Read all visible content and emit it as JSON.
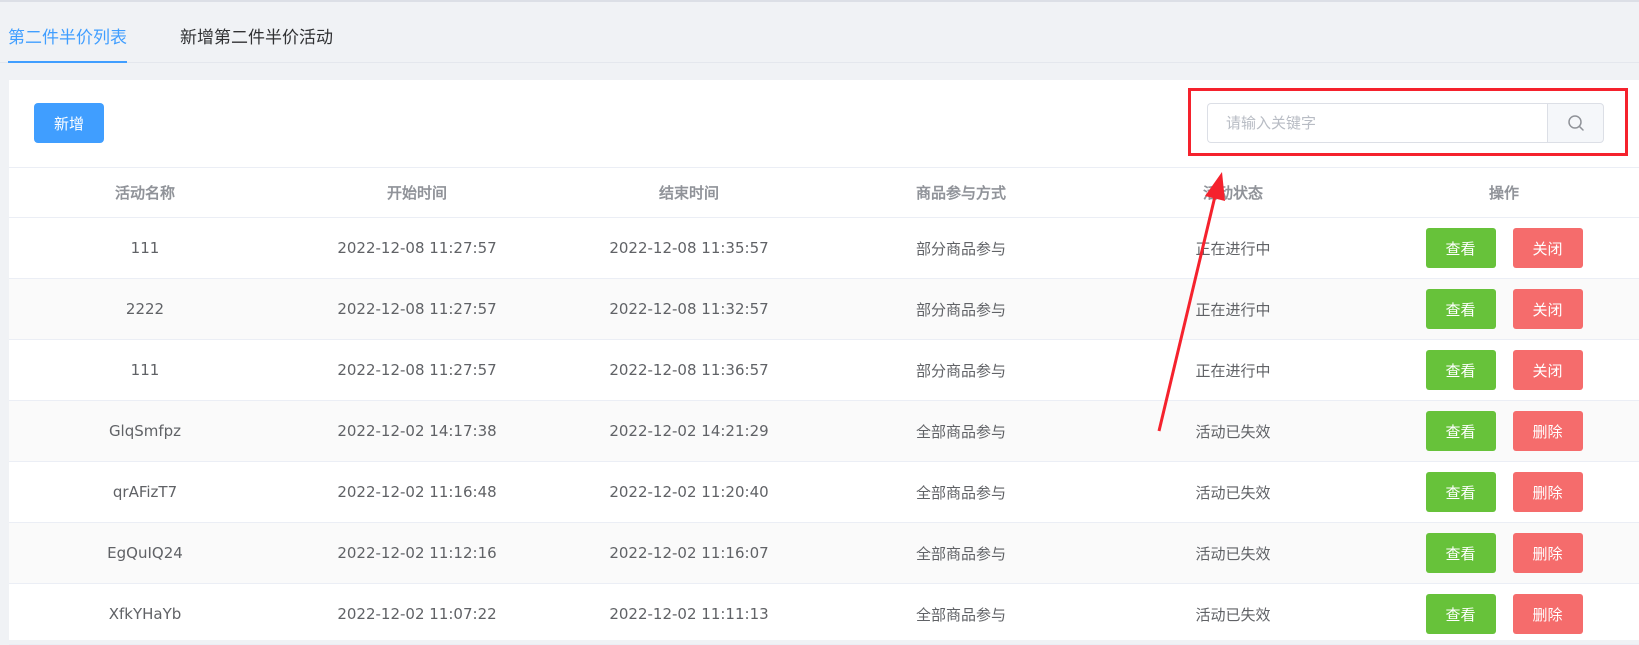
{
  "tabs": [
    {
      "label": "第二件半价列表",
      "active": true
    },
    {
      "label": "新增第二件半价活动",
      "active": false
    }
  ],
  "toolbar": {
    "add_label": "新增",
    "search_placeholder": "请输入关键字",
    "search_value": "",
    "search_icon": "search-icon"
  },
  "colors": {
    "primary": "#409eff",
    "success": "#67c23a",
    "danger": "#f56c6c",
    "annotation": "#f5222d"
  },
  "table": {
    "headers": [
      "活动名称",
      "开始时间",
      "结束时间",
      "商品参与方式",
      "活动状态",
      "操作"
    ],
    "rows": [
      {
        "name": "111",
        "start": "2022-12-08 11:27:57",
        "end": "2022-12-08 11:35:57",
        "mode": "部分商品参与",
        "status": "正在进行中",
        "view": "查看",
        "action": "关闭"
      },
      {
        "name": "2222",
        "start": "2022-12-08 11:27:57",
        "end": "2022-12-08 11:32:57",
        "mode": "部分商品参与",
        "status": "正在进行中",
        "view": "查看",
        "action": "关闭"
      },
      {
        "name": "111",
        "start": "2022-12-08 11:27:57",
        "end": "2022-12-08 11:36:57",
        "mode": "部分商品参与",
        "status": "正在进行中",
        "view": "查看",
        "action": "关闭"
      },
      {
        "name": "GlqSmfpz",
        "start": "2022-12-02 14:17:38",
        "end": "2022-12-02 14:21:29",
        "mode": "全部商品参与",
        "status": "活动已失效",
        "view": "查看",
        "action": "删除"
      },
      {
        "name": "qrAFizT7",
        "start": "2022-12-02 11:16:48",
        "end": "2022-12-02 11:20:40",
        "mode": "全部商品参与",
        "status": "活动已失效",
        "view": "查看",
        "action": "删除"
      },
      {
        "name": "EgQuIQ24",
        "start": "2022-12-02 11:12:16",
        "end": "2022-12-02 11:16:07",
        "mode": "全部商品参与",
        "status": "活动已失效",
        "view": "查看",
        "action": "删除"
      },
      {
        "name": "XfkYHaYb",
        "start": "2022-12-02 11:07:22",
        "end": "2022-12-02 11:11:13",
        "mode": "全部商品参与",
        "status": "活动已失效",
        "view": "查看",
        "action": "删除"
      }
    ]
  }
}
